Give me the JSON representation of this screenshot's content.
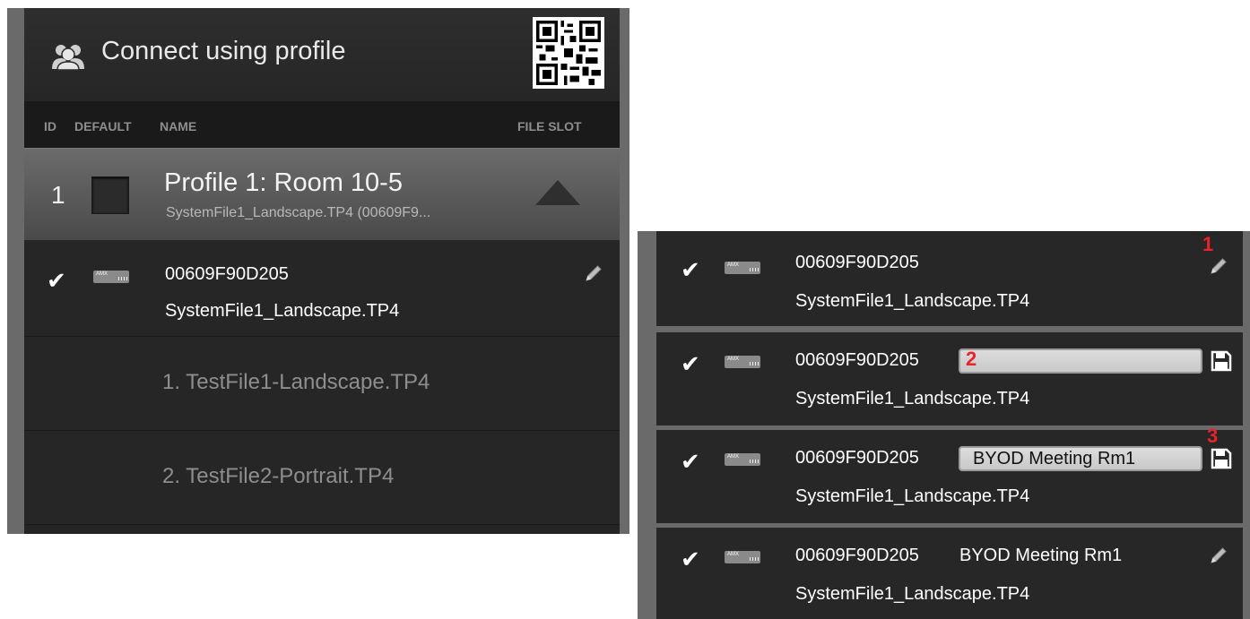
{
  "left": {
    "header": {
      "title": "Connect using profile"
    },
    "columns": {
      "id": "ID",
      "default": "DEFAULT",
      "name": "NAME",
      "file_slot": "FILE SLOT"
    },
    "profile": {
      "id": "1",
      "name": "Profile 1: Room 10-5",
      "file": "SystemFile1_Landscape.TP4 (00609F9..."
    },
    "device": {
      "id": "00609F90D205",
      "file": "SystemFile1_Landscape.TP4",
      "badge": "AMX"
    },
    "file_slots": [
      "1. TestFile1-Landscape.TP4",
      "2. TestFile2-Portrait.TP4"
    ]
  },
  "right": {
    "rows": [
      {
        "id": "00609F90D205",
        "file": "SystemFile1_Landscape.TP4",
        "marker": "1"
      },
      {
        "id": "00609F90D205",
        "file": "SystemFile1_Landscape.TP4",
        "marker": "2",
        "input_value": ""
      },
      {
        "id": "00609F90D205",
        "file": "SystemFile1_Landscape.TP4",
        "marker": "3",
        "input_value": "BYOD Meeting Rm1"
      },
      {
        "id": "00609F90D205",
        "file": "SystemFile1_Landscape.TP4",
        "name": "BYOD Meeting Rm1"
      }
    ],
    "badge": "AMX"
  },
  "icons": {
    "header": "people-group-icon",
    "qr": "qr-code-icon",
    "check": "checkmark-icon",
    "edit": "pencil-icon",
    "save": "floppy-save-icon",
    "collapse": "triangle-up-icon",
    "device": "amx-device-icon"
  },
  "colors": {
    "marker": "#e8242a",
    "panel": "#242424",
    "frame": "#6a6a6a"
  }
}
